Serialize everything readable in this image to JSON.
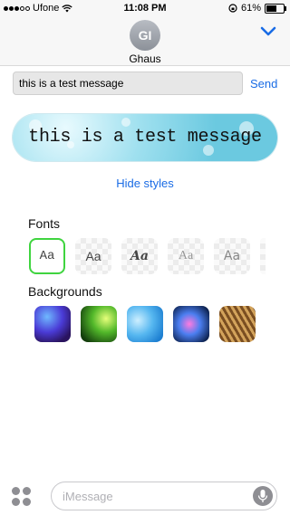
{
  "status_bar": {
    "carrier": "Ufone",
    "time": "11:08 PM",
    "battery": "61%"
  },
  "header": {
    "avatar_initials": "GI",
    "contact_name": "Ghaus"
  },
  "compose": {
    "value": "this is a test message",
    "send_label": "Send"
  },
  "preview": {
    "text": "this is a test message"
  },
  "hide_styles_label": "Hide styles",
  "fonts": {
    "label": "Fonts",
    "options": [
      {
        "sample": "Aa",
        "selected": true
      },
      {
        "sample": "Aa",
        "selected": false
      },
      {
        "sample": "Aa",
        "selected": false
      },
      {
        "sample": "Aa",
        "selected": false
      },
      {
        "sample": "Aa",
        "selected": false
      }
    ]
  },
  "backgrounds": {
    "label": "Backgrounds",
    "options": [
      {
        "name": "purple-blue-nebula"
      },
      {
        "name": "green-glow"
      },
      {
        "name": "blue-bokeh"
      },
      {
        "name": "teal-pink-galaxy"
      },
      {
        "name": "gold-feathers"
      }
    ]
  },
  "message_input": {
    "placeholder": "iMessage"
  },
  "colors": {
    "accent": "#1a6ce5",
    "selected_border": "#3fd43f"
  }
}
